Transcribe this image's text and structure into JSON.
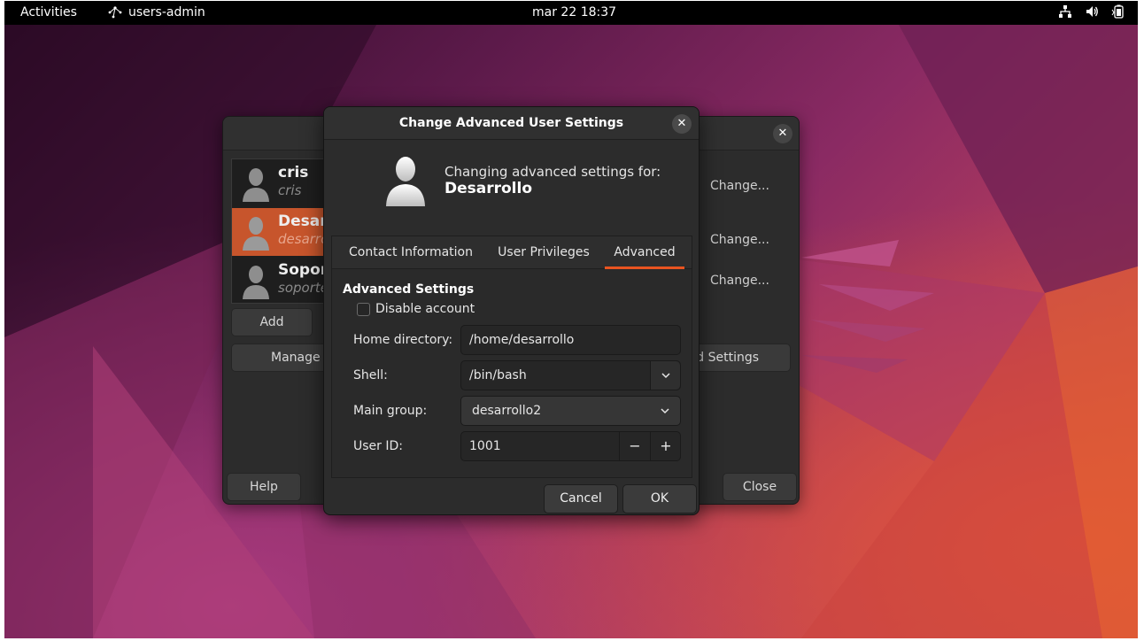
{
  "topbar": {
    "activities": "Activities",
    "app_name": "users-admin",
    "clock": "mar 22  18:37",
    "tray_icons": [
      "network-icon",
      "volume-icon",
      "battery-icon"
    ]
  },
  "main_window": {
    "users": [
      {
        "name": "cris",
        "login": "cris"
      },
      {
        "name": "Desarrollo",
        "login": "desarrollo"
      },
      {
        "name": "Soporte",
        "login": "soporte"
      }
    ],
    "add_label": "Add",
    "manage_label": "Manage Groups",
    "change_labels": [
      "Change...",
      "Change...",
      "Change..."
    ],
    "advanced_settings_label": "Advanced Settings",
    "help_label": "Help",
    "close_label": "Close"
  },
  "dialog": {
    "title": "Change Advanced User Settings",
    "subtitle": "Changing advanced settings for:",
    "username": "Desarrollo",
    "tabs": [
      "Contact Information",
      "User Privileges",
      "Advanced"
    ],
    "active_tab": "Advanced",
    "section_title": "Advanced Settings",
    "disable_account_label": "Disable account",
    "disable_account_checked": false,
    "home_label": "Home directory:",
    "home_value": "/home/desarrollo",
    "shell_label": "Shell:",
    "shell_value": "/bin/bash",
    "group_label": "Main group:",
    "group_value": "desarrollo2",
    "uid_label": "User ID:",
    "uid_value": "1001",
    "minus": "−",
    "plus": "+",
    "cancel_label": "Cancel",
    "ok_label": "OK",
    "close_glyph": "✕"
  },
  "colors": {
    "accent": "#e95420",
    "selection": "#c7552c",
    "window_bg": "#2c2c2c"
  }
}
